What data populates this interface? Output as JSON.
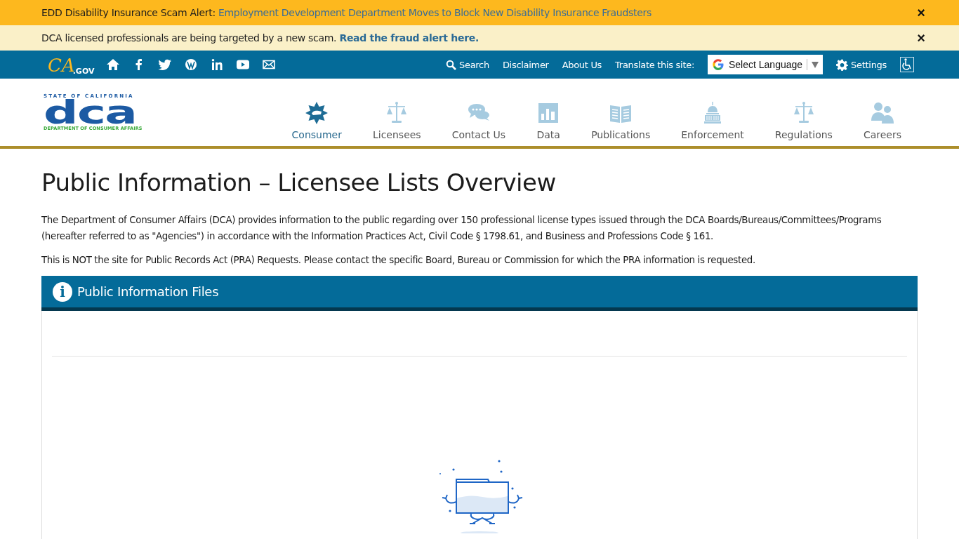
{
  "alerts": [
    {
      "kind": "warning",
      "text": "EDD Disability Insurance Scam Alert:",
      "link": "Employment Development Department Moves to Block New Disability Insurance Fraudsters",
      "close": "×"
    },
    {
      "kind": "notice",
      "text": "DCA licensed professionals are being targeted by a new scam.",
      "link": "Read the fraud alert here.",
      "close": "×"
    }
  ],
  "utility_bar": {
    "ca_logo": {
      "mark": "CA",
      ".gov": ".GOV"
    },
    "social": [
      {
        "kind": "home"
      },
      {
        "kind": "facebook"
      },
      {
        "kind": "twitter"
      },
      {
        "kind": "wordpress"
      },
      {
        "kind": "linkedin"
      },
      {
        "kind": "youtube"
      },
      {
        "kind": "email"
      }
    ],
    "links": [
      "Search",
      "Disclaimer",
      "About Us"
    ],
    "translate_label": "Translate this site:",
    "language_select": "Select Language",
    "settings": "Settings"
  },
  "logo": {
    "top": "STATE OF CALIFORNIA",
    "main": "dca",
    "bottom": "DEPARTMENT OF CONSUMER AFFAIRS"
  },
  "nav": [
    {
      "label": "Consumer",
      "kind": "star",
      "selected": true
    },
    {
      "label": "Licensees",
      "kind": "scale",
      "selected": false
    },
    {
      "label": "Contact Us",
      "kind": "chat",
      "selected": false
    },
    {
      "label": "Data",
      "kind": "chart",
      "selected": false
    },
    {
      "label": "Publications",
      "kind": "book",
      "selected": false
    },
    {
      "label": "Enforcement",
      "kind": "capitol",
      "selected": false
    },
    {
      "label": "Regulations",
      "kind": "scale",
      "selected": false
    },
    {
      "label": "Careers",
      "kind": "people",
      "selected": false
    }
  ],
  "page": {
    "title": "Public Information – Licensee Lists Overview",
    "paragraphs": [
      "The Department of Consumer Affairs (DCA) provides information to the public regarding over 150 professional license types issued through the DCA Boards/Bureaus/Committees/Programs (hereafter referred to as \"Agencies\") in accordance with the Information Practices Act, Civil Code § 1798.61, and Business and Professions Code § 161.",
      "This is NOT the site for Public Records Act (PRA) Requests. Please contact the specific Board, Bureau or Commission for which the PRA information is requested."
    ],
    "panel": {
      "title": "Public Information Files",
      "info_icon": "i"
    }
  }
}
